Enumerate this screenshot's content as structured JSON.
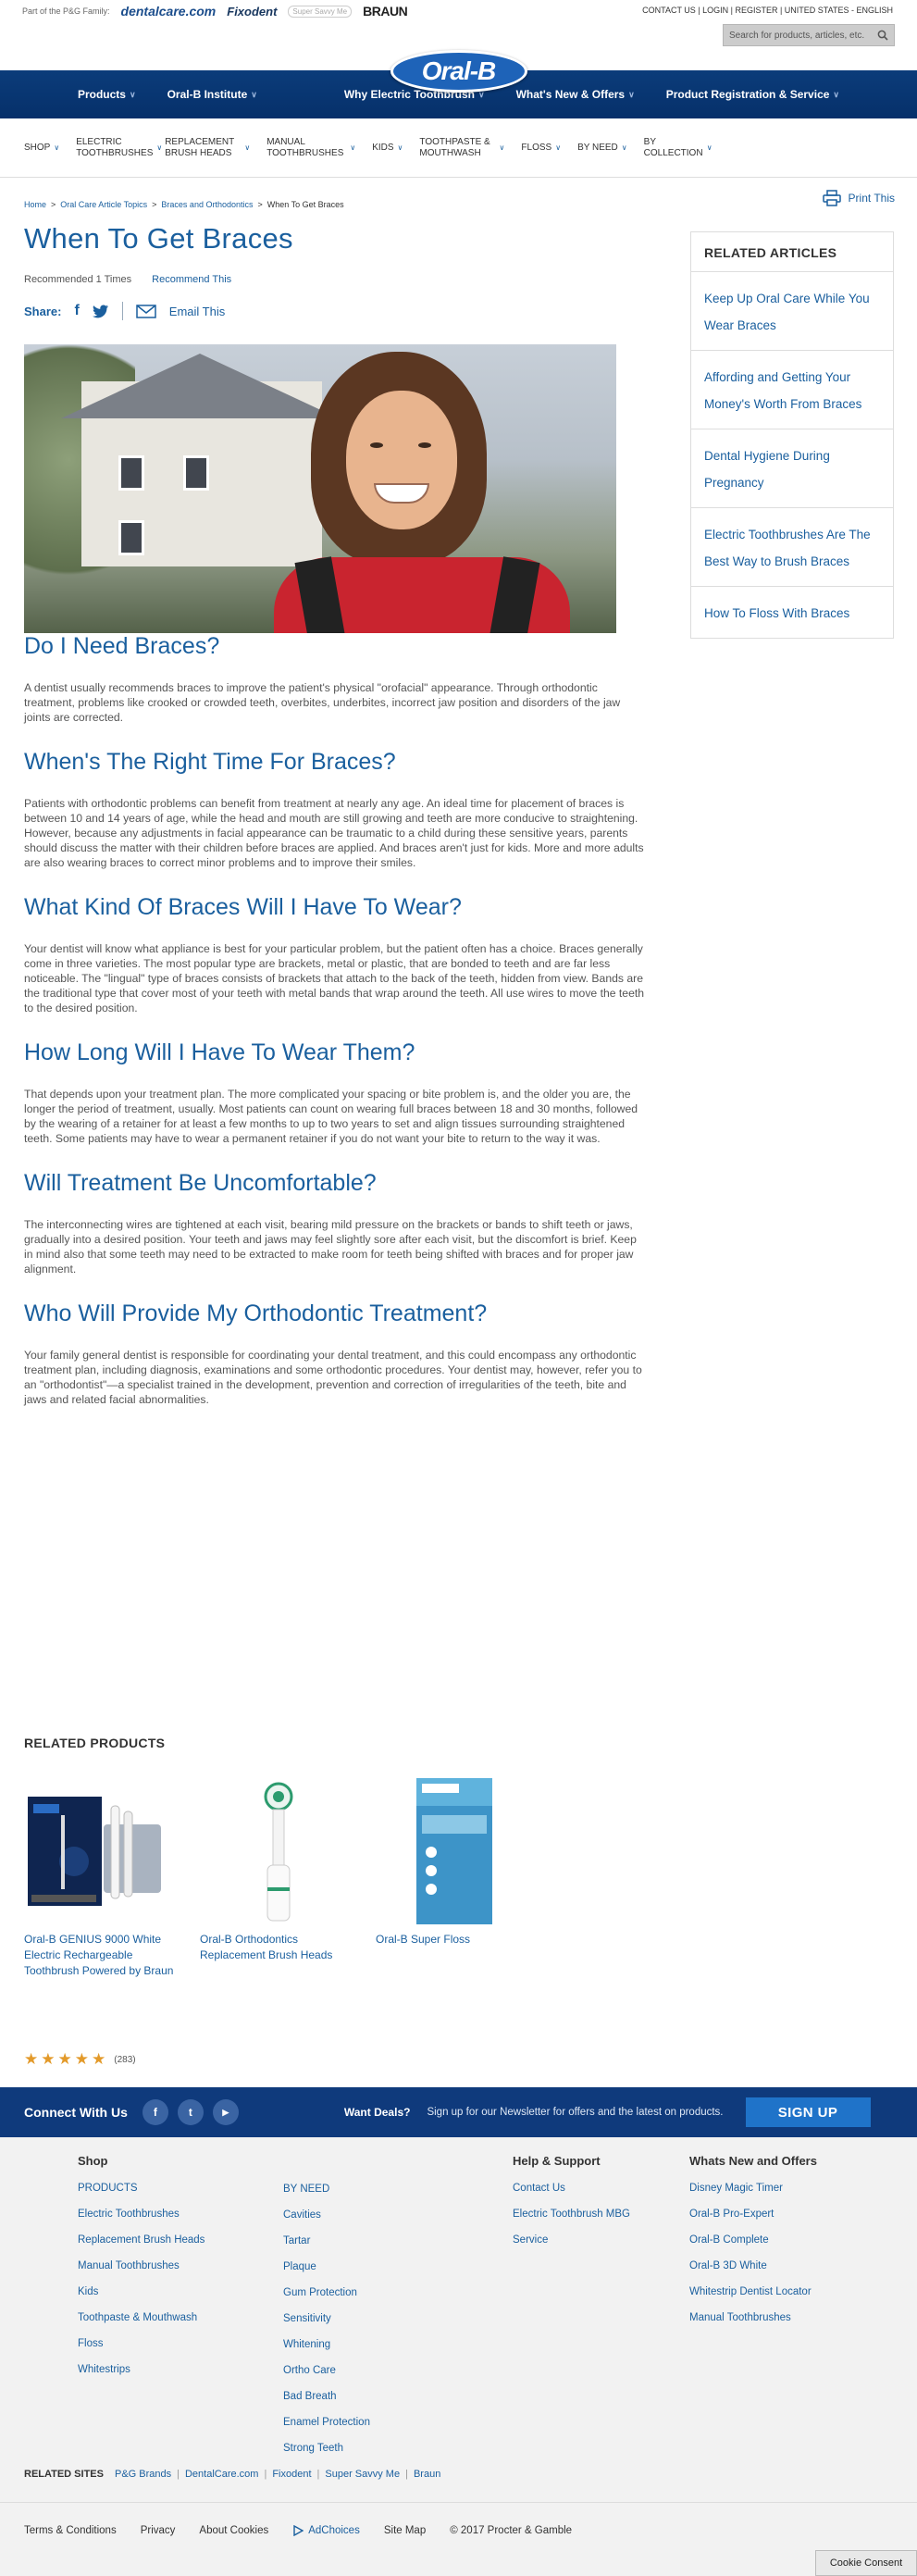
{
  "topbar": {
    "pg_family": "Part of the P&G Family:",
    "brands": [
      "dentalcare.com",
      "Fixodent",
      "Super Savvy Me",
      "BRAUN"
    ],
    "links": "CONTACT US | LOGIN | REGISTER | UNITED STATES - ENGLISH",
    "search_placeholder": "Search for products, articles, etc."
  },
  "logo": "Oral-B",
  "main_nav": [
    "Products",
    "Oral-B Institute",
    "Why Electric Toothbrush",
    "What's New & Offers",
    "Product Registration & Service"
  ],
  "sub_nav": [
    {
      "label": "SHOP"
    },
    {
      "label": "ELECTRIC TOOTHBRUSHES"
    },
    {
      "label": "REPLACEMENT BRUSH HEADS"
    },
    {
      "label": "MANUAL TOOTHBRUSHES"
    },
    {
      "label": "KIDS"
    },
    {
      "label": "TOOTHPASTE & MOUTHWASH"
    },
    {
      "label": "FLOSS"
    },
    {
      "label": "BY NEED"
    },
    {
      "label": "BY COLLECTION"
    }
  ],
  "breadcrumb": [
    "Home",
    "Oral Care Article Topics",
    "Braces and Orthodontics",
    "When To Get Braces"
  ],
  "print_label": "Print This",
  "article": {
    "title": "When To Get Braces",
    "recommended": "Recommended 1 Times",
    "recommend_link": "Recommend This",
    "share_label": "Share:",
    "email_label": "Email This",
    "sections": [
      {
        "heading": "Do I Need Braces?",
        "body": "A dentist usually recommends braces to improve the patient's physical \"orofacial\" appearance. Through orthodontic treatment, problems like crooked or crowded teeth, overbites, underbites, incorrect jaw position and disorders of the jaw joints are corrected."
      },
      {
        "heading": "When's The Right Time For Braces?",
        "body": "Patients with orthodontic problems can benefit from treatment at nearly any age. An ideal time for placement of braces is between 10 and 14 years of age, while the head and mouth are still growing and teeth are more conducive to straightening. However, because any adjustments in facial appearance can be traumatic to a child during these sensitive years, parents should discuss the matter with their children before braces are applied. And braces aren't just for kids. More and more adults are also wearing braces to correct minor problems and to improve their smiles."
      },
      {
        "heading": "What Kind Of Braces Will I Have To Wear?",
        "body": "Your dentist will know what appliance is best for your particular problem, but the patient often has a choice. Braces generally come in three varieties. The most popular type are brackets, metal or plastic, that are bonded to teeth and are far less noticeable. The \"lingual\" type of braces consists of brackets that attach to the back of the teeth, hidden from view. Bands are the traditional type that cover most of your teeth with metal bands that wrap around the teeth. All use wires to move the teeth to the desired position."
      },
      {
        "heading": "How Long Will I Have To Wear Them?",
        "body": "That depends upon your treatment plan. The more complicated your spacing or bite problem is, and the older you are, the longer the period of treatment, usually. Most patients can count on wearing full braces between 18 and 30 months, followed by the wearing of a retainer for at least a few months to up to two years to set and align tissues surrounding straightened teeth. Some patients may have to wear a permanent retainer if you do not want your bite to return to the way it was."
      },
      {
        "heading": "Will Treatment Be Uncomfortable?",
        "body": "The interconnecting wires are tightened at each visit, bearing mild pressure on the brackets or bands to shift teeth or jaws, gradually into a desired position. Your teeth and jaws may feel slightly sore after each visit, but the discomfort is brief. Keep in mind also that some teeth may need to be extracted to make room for teeth being shifted with braces and for proper jaw alignment."
      },
      {
        "heading": "Who Will Provide My Orthodontic Treatment?",
        "body": "Your family general dentist is responsible for coordinating your dental treatment, and this could encompass any orthodontic treatment plan, including diagnosis, examinations and some orthodontic procedures. Your dentist may, however, refer you to an \"orthodontist\"—a specialist trained in the development, prevention and correction of irregularities of the teeth, bite and jaws and related facial abnormalities."
      }
    ]
  },
  "related_articles": {
    "title": "RELATED ARTICLES",
    "items": [
      "Keep Up Oral Care While You Wear Braces",
      "Affording and Getting Your Money's Worth From Braces",
      "Dental Hygiene During Pregnancy",
      "Electric Toothbrushes Are The Best Way to Brush Braces",
      "How To Floss With Braces"
    ]
  },
  "related_products": {
    "title": "RELATED PRODUCTS",
    "items": [
      {
        "name": "Oral-B GENIUS 9000 White Electric Rechargeable Toothbrush Powered by Braun"
      },
      {
        "name": "Oral-B Orthodontics Replacement Brush Heads"
      },
      {
        "name": "Oral-B Super Floss"
      }
    ],
    "rating": {
      "stars": 5,
      "count": "(283)"
    }
  },
  "connect": {
    "label": "Connect With Us",
    "deals": "Want Deals?",
    "newsletter": "Sign up for our Newsletter for offers and the latest on products.",
    "signup": "SIGN UP"
  },
  "footer": {
    "shop_title": "Shop",
    "shop_col1": [
      "PRODUCTS",
      "Electric Toothbrushes",
      "Replacement Brush Heads",
      "Manual Toothbrushes",
      "Kids",
      "Toothpaste & Mouthwash",
      "Floss",
      "Whitestrips"
    ],
    "shop_col2": [
      "BY NEED",
      "Cavities",
      "Tartar",
      "Plaque",
      "Gum Protection",
      "Sensitivity",
      "Whitening",
      "Ortho Care",
      "Bad Breath",
      "Enamel Protection",
      "Strong Teeth"
    ],
    "help_title": "Help & Support",
    "help": [
      "Contact Us",
      "Electric Toothbrush MBG",
      "Service"
    ],
    "whats_new_title": "Whats New and Offers",
    "whats_new": [
      "Disney Magic Timer",
      "Oral-B Pro-Expert",
      "Oral-B Complete",
      "Oral-B 3D White",
      "Whitestrip Dentist Locator",
      "Manual Toothbrushes"
    ],
    "related_sites_label": "RELATED SITES",
    "related_sites": [
      "P&G Brands",
      "DentalCare.com",
      "Fixodent",
      "Super Savvy Me",
      "Braun"
    ],
    "bottom": [
      "Terms & Conditions",
      "Privacy",
      "About Cookies",
      "AdChoices",
      "Site Map"
    ],
    "copyright": "© 2017 Procter & Gamble",
    "cookie": "Cookie Consent"
  }
}
